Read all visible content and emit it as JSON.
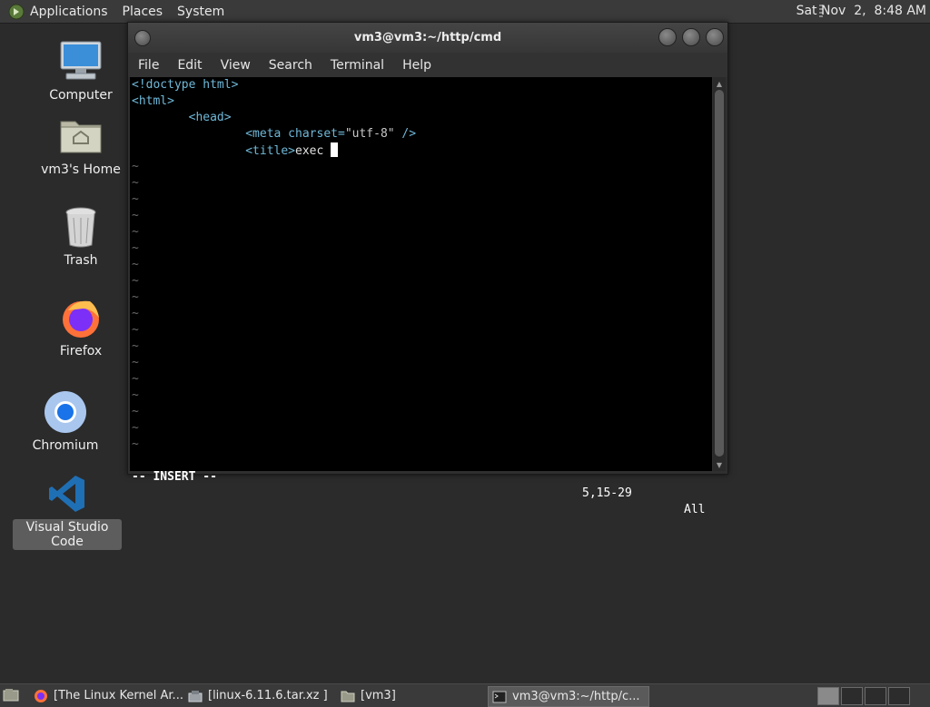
{
  "top_panel": {
    "menus": [
      "Applications",
      "Places",
      "System"
    ],
    "clock": "Sat Nov  2,  8:48 AM"
  },
  "desktop": {
    "icons": [
      {
        "label": "Computer",
        "icon": "computer-icon"
      },
      {
        "label": "vm3's Home",
        "icon": "home-folder-icon"
      },
      {
        "label": "Trash",
        "icon": "trash-icon"
      },
      {
        "label": "Firefox",
        "icon": "firefox-icon"
      },
      {
        "label": "Chromium",
        "icon": "chromium-icon"
      },
      {
        "label": "Visual Studio Code",
        "icon": "vscode-icon",
        "selected": true
      }
    ]
  },
  "terminal": {
    "title": "vm3@vm3:~/http/cmd",
    "menu": [
      "File",
      "Edit",
      "View",
      "Search",
      "Terminal",
      "Help"
    ],
    "lines": {
      "l1": "<!doctype html>",
      "l2": "<html>",
      "l3": "        <head>",
      "l4a": "                <meta charset=",
      "l4b": "\"utf-8\"",
      "l4c": " />",
      "l5a": "                <title>",
      "l5b": "exec "
    },
    "tilde": "~",
    "status": {
      "mode": "-- INSERT --",
      "position": "5,15-29",
      "scroll": "All"
    }
  },
  "taskbar": {
    "tasks": [
      {
        "label": "[The Linux Kernel Ar...",
        "icon": "firefox-icon"
      },
      {
        "label": "[linux-6.11.6.tar.xz ]",
        "icon": "archive-icon"
      },
      {
        "label": "[vm3]",
        "icon": "folder-icon"
      },
      {
        "label": "vm3@vm3:~/http/c...",
        "icon": "terminal-icon",
        "active": true
      }
    ]
  }
}
